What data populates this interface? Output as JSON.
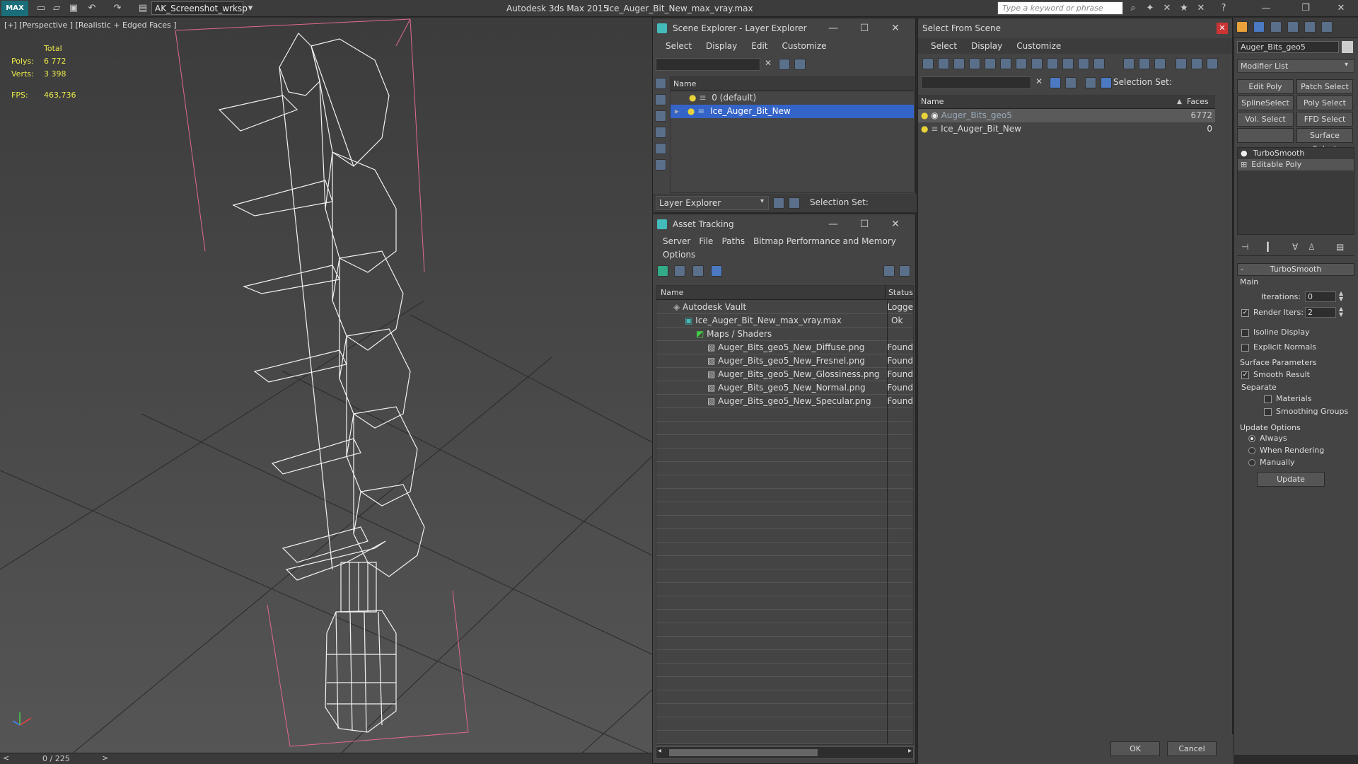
{
  "app": {
    "logo": "MAX",
    "workspace": "AK_Screenshot_wrksp",
    "product": "Autodesk 3ds Max  2015",
    "file": "Ice_Auger_Bit_New_max_vray.max",
    "search_placeholder": "Type a keyword or phrase"
  },
  "viewport": {
    "label": "[+] [Perspective ] [Realistic + Edged Faces ]",
    "stats": {
      "total_label": "Total",
      "polys_label": "Polys:",
      "polys": "6 772",
      "verts_label": "Verts:",
      "verts": "3 398",
      "fps_label": "FPS:",
      "fps": "463,736"
    }
  },
  "scene_explorer": {
    "title": "Scene Explorer - Layer Explorer",
    "menu": [
      "Select",
      "Display",
      "Edit",
      "Customize"
    ],
    "column": "Name",
    "rows": [
      "0 (default)",
      "Ice_Auger_Bit_New"
    ],
    "footer_mode": "Layer Explorer",
    "footer_selection": "Selection Set:"
  },
  "asset_tracking": {
    "title": "Asset Tracking",
    "menu": [
      "Server",
      "File",
      "Paths",
      "Bitmap Performance and Memory"
    ],
    "menu2": "Options",
    "col_name": "Name",
    "col_status": "Status",
    "rows": [
      {
        "name": "Autodesk Vault",
        "status": "Logge",
        "indent": 0
      },
      {
        "name": "Ice_Auger_Bit_New_max_vray.max",
        "status": "Ok",
        "indent": 1
      },
      {
        "name": "Maps / Shaders",
        "status": "",
        "indent": 2
      },
      {
        "name": "Auger_Bits_geo5_New_Diffuse.png",
        "status": "Found",
        "indent": 3
      },
      {
        "name": "Auger_Bits_geo5_New_Fresnel.png",
        "status": "Found",
        "indent": 3
      },
      {
        "name": "Auger_Bits_geo5_New_Glossiness.png",
        "status": "Found",
        "indent": 3
      },
      {
        "name": "Auger_Bits_geo5_New_Normal.png",
        "status": "Found",
        "indent": 3
      },
      {
        "name": "Auger_Bits_geo5_New_Specular.png",
        "status": "Found",
        "indent": 3
      }
    ]
  },
  "select_from_scene": {
    "title": "Select From Scene",
    "menu": [
      "Select",
      "Display",
      "Customize"
    ],
    "selection_set": "Selection Set:",
    "col_name": "Name",
    "col_faces": "Faces",
    "rows": [
      {
        "name": "Auger_Bits_geo5",
        "faces": "6772"
      },
      {
        "name": "Ice_Auger_Bit_New",
        "faces": "0"
      }
    ],
    "ok": "OK",
    "cancel": "Cancel"
  },
  "command_panel": {
    "object_name": "Auger_Bits_geo5",
    "modifier_list": "Modifier List",
    "buttons": [
      "Edit Poly",
      "Patch Select",
      "SplineSelect",
      "Poly Select",
      "Vol. Select",
      "FFD Select",
      "",
      "Surface Select"
    ],
    "stack": [
      "TurboSmooth",
      "Editable Poly"
    ],
    "rollout_title": "TurboSmooth",
    "main_label": "Main",
    "iterations_label": "Iterations:",
    "iterations": "0",
    "render_iters_label": "Render Iters:",
    "render_iters": "2",
    "isoline": "Isoline Display",
    "explicit": "Explicit Normals",
    "surface_params": "Surface Parameters",
    "smooth_result": "Smooth Result",
    "separate": "Separate",
    "materials": "Materials",
    "smoothing_groups": "Smoothing Groups",
    "update_options": "Update Options",
    "always": "Always",
    "when_rendering": "When Rendering",
    "manually": "Manually",
    "update": "Update"
  },
  "timeline": {
    "frame": "0 / 225"
  }
}
